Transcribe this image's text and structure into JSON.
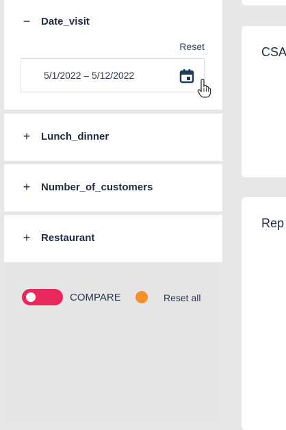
{
  "filters": {
    "date_visit": {
      "label": "Date_visit",
      "expanded_sign": "−",
      "reset_label": "Reset",
      "date_range": "5/1/2022 – 5/12/2022",
      "calendar_icon": "calendar-icon"
    },
    "lunch_dinner": {
      "label": "Lunch_dinner",
      "sign": "+"
    },
    "number_of_customers": {
      "label": "Number_of_customers",
      "sign": "+"
    },
    "restaurant": {
      "label": "Restaurant",
      "sign": "+"
    }
  },
  "footer": {
    "compare_label": "COMPARE",
    "compare_toggle_on": true,
    "reset_all_label": "Reset all",
    "toggle_color": "#e8275a",
    "dot_color": "#f7902c"
  },
  "right_panel": {
    "cards": [
      {
        "title": "CSA"
      },
      {
        "title": "Rep"
      }
    ]
  },
  "colors": {
    "text": "#1f2a44",
    "panel_bg": "#e6e6e7",
    "card_bg": "#ffffff"
  }
}
